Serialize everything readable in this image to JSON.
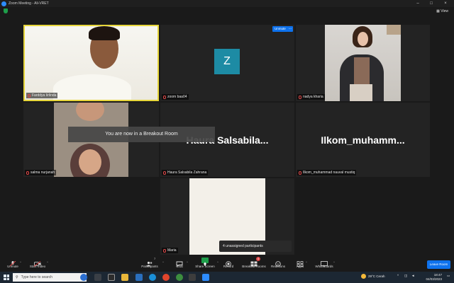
{
  "window": {
    "title": "Zoom Meeting - Ali-VRET",
    "controls": [
      "minimize-icon",
      "maximize-icon",
      "close-icon"
    ],
    "view_label": "View"
  },
  "tiles": [
    {
      "name": "Farddya Iirlinda",
      "type": "video"
    },
    {
      "name": "zoom baa04",
      "type": "avatar",
      "avatar_letter": "Z",
      "avatar_color": "#1d8ba4"
    },
    {
      "name": "nadya kharia",
      "type": "video"
    },
    {
      "name": "salma nurjanah",
      "type": "video"
    },
    {
      "name": "Haura Salsabila Zahrana",
      "type": "name",
      "display": "Haura  Salsabila..."
    },
    {
      "name": "Ilkom_muhammad nauval mustiq",
      "type": "name",
      "display": "Ilkom_muhamm..."
    },
    {
      "name": "Maria",
      "type": "video"
    }
  ],
  "tile_controls": {
    "unmute_label": "Unmute",
    "more_label": "..."
  },
  "toast": "You are now in a Breakout Room",
  "unassigned": "4 unassigned participants",
  "toolbar": {
    "items": [
      {
        "label": "Unmute",
        "icon": "mic-off-icon"
      },
      {
        "label": "Start Video",
        "icon": "video-off-icon"
      },
      {
        "label": "Participants",
        "icon": "participants-icon",
        "count": "7"
      },
      {
        "label": "Chat",
        "icon": "chat-icon"
      },
      {
        "label": "Share Screen",
        "icon": "share-screen-icon"
      },
      {
        "label": "Record",
        "icon": "record-icon"
      },
      {
        "label": "Breakout Rooms",
        "icon": "breakout-rooms-icon",
        "badge": "4"
      },
      {
        "label": "Reactions",
        "icon": "reactions-icon"
      },
      {
        "label": "Apps",
        "icon": "apps-icon"
      },
      {
        "label": "Whiteboards",
        "icon": "whiteboards-icon"
      }
    ],
    "leave_label": "Leave Room"
  },
  "taskbar": {
    "search_placeholder": "Type here to search",
    "weather": "29°C  Cerah",
    "time": "18:47",
    "date": "04/03/2023"
  },
  "colors": {
    "accent": "#0e72ed",
    "share": "#1e9e4a",
    "background": "#1a1a1a",
    "tile": "#232323",
    "active_border": "#e7d63b"
  }
}
